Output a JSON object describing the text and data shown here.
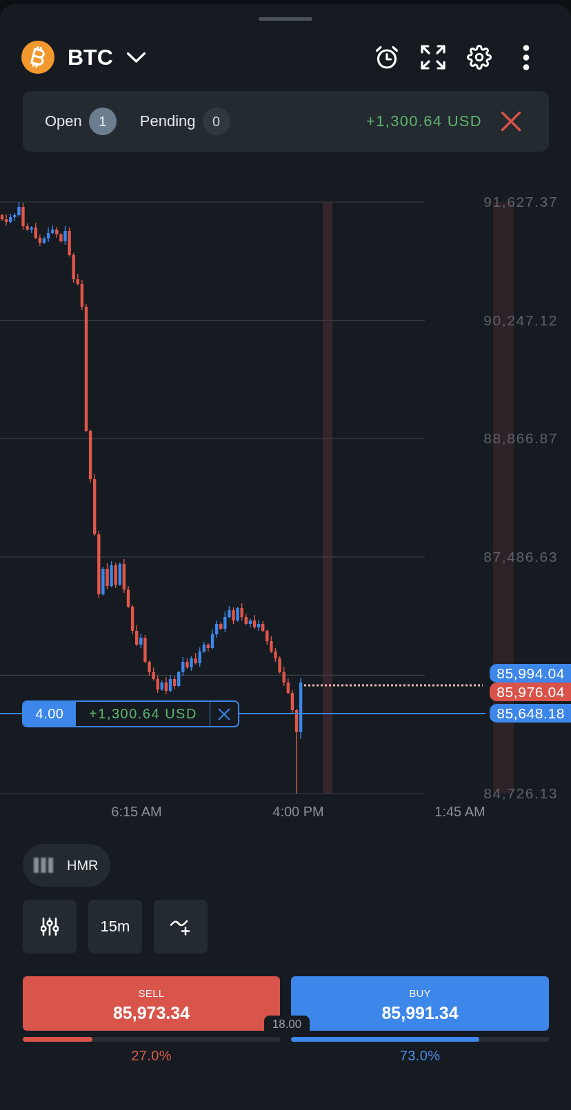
{
  "header": {
    "symbol": "BTC"
  },
  "orders": {
    "tabs": [
      {
        "label": "Open",
        "count": "1",
        "selected": true
      },
      {
        "label": "Pending",
        "count": "0",
        "selected": false
      }
    ],
    "total_profit": "+1,300.64 USD"
  },
  "chart": {
    "price_labels": [
      "91,627.37",
      "90,247.12",
      "88,866.87",
      "87,486.63",
      "84,726.13"
    ],
    "time_labels": [
      "6:15 AM",
      "4:00 PM",
      "1:45 AM"
    ],
    "price_tags": [
      {
        "kind": "ask",
        "text": "85,994.04"
      },
      {
        "kind": "bid",
        "text": "85,976.04"
      },
      {
        "kind": "position",
        "text": "85,648.18"
      }
    ],
    "position": {
      "volume": "4.00",
      "profit": "+1,300.64 USD"
    }
  },
  "indicator": {
    "label": "HMR"
  },
  "tools": [
    {
      "kind": "indicators"
    },
    {
      "kind": "timeframe",
      "label": "15m"
    },
    {
      "kind": "drawing"
    }
  ],
  "trade": {
    "sides": [
      {
        "kind": "sell",
        "label": "SELL",
        "price": "85,973.34",
        "level": 0.27,
        "reading": "27.0%"
      },
      {
        "kind": "buy",
        "label": "BUY",
        "price": "85,991.34",
        "level": 0.73,
        "reading": "73.0%"
      }
    ],
    "spread": "18.00"
  }
}
